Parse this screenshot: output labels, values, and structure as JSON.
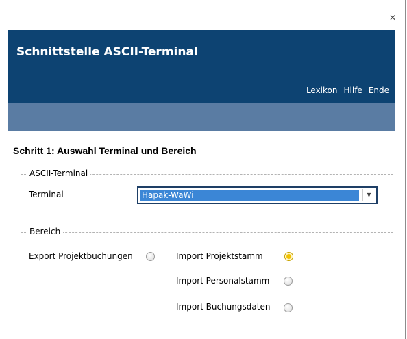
{
  "window": {
    "close_glyph": "✕"
  },
  "header": {
    "title": "Schnittstelle ASCII-Terminal",
    "links": [
      "Lexikon",
      "Hilfe",
      "Ende"
    ]
  },
  "step": {
    "title": "Schritt 1: Auswahl Terminal und Bereich"
  },
  "terminal_group": {
    "legend": "ASCII-Terminal",
    "label": "Terminal",
    "selected_value": "Hapak-WaWi",
    "selection_color": "#3b86d6"
  },
  "bereich_group": {
    "legend": "Bereich",
    "options": [
      {
        "label": "Export Projektbuchungen",
        "checked": false
      },
      {
        "label": "Import Projektstamm",
        "checked": true
      },
      {
        "label": "Import Personalstamm",
        "checked": false
      },
      {
        "label": "Import Buchungsdaten",
        "checked": false
      }
    ]
  },
  "colors": {
    "header_bg": "#0d4372",
    "subheader_bg": "#5a7ca3",
    "radio_checked": "#f2c200"
  }
}
